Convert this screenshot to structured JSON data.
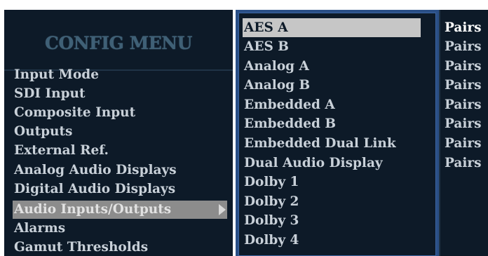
{
  "config_menu": {
    "title": "CONFIG MENU",
    "items": [
      {
        "label": "Input Mode"
      },
      {
        "label": "SDI Input"
      },
      {
        "label": "Composite Input"
      },
      {
        "label": "Outputs"
      },
      {
        "label": "External Ref."
      },
      {
        "label": "Analog Audio Displays"
      },
      {
        "label": "Digital Audio Displays"
      },
      {
        "label": "Audio Inputs/Outputs",
        "selected": true
      },
      {
        "label": "Alarms"
      },
      {
        "label": "Gamut Thresholds"
      }
    ]
  },
  "submenu": {
    "items": [
      {
        "label": "AES A",
        "selected": true
      },
      {
        "label": "AES B"
      },
      {
        "label": "Analog A"
      },
      {
        "label": "Analog B"
      },
      {
        "label": "Embedded A"
      },
      {
        "label": "Embedded B"
      },
      {
        "label": "Embedded Dual Link"
      },
      {
        "label": "Dual Audio Display"
      },
      {
        "label": "Dolby 1"
      },
      {
        "label": "Dolby 2"
      },
      {
        "label": "Dolby 3"
      },
      {
        "label": "Dolby 4"
      }
    ]
  },
  "values": {
    "items": [
      "Pairs",
      "Pairs",
      "Pairs",
      "Pairs",
      "Pairs",
      "Pairs",
      "Pairs",
      "Pairs"
    ]
  }
}
